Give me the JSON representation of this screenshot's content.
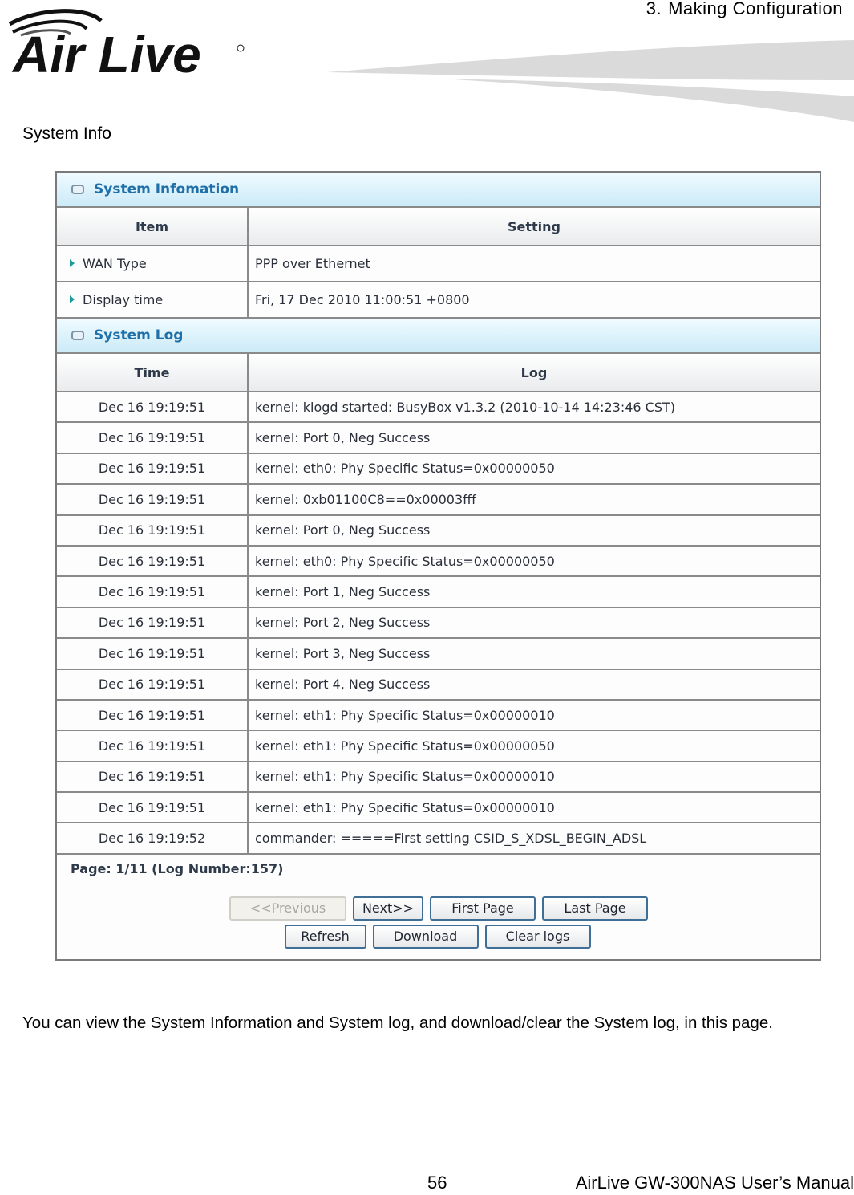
{
  "header": {
    "brand": "Air Live",
    "chapter_number": "3.",
    "chapter_title": "Making Configuration"
  },
  "section_title": "System Info",
  "system_information": {
    "title": "System Infomation",
    "columns": [
      "Item",
      "Setting"
    ],
    "rows": [
      {
        "item": "WAN Type",
        "setting": "PPP over Ethernet"
      },
      {
        "item": "Display time",
        "setting": "Fri, 17 Dec 2010 11:00:51 +0800"
      }
    ]
  },
  "system_log": {
    "title": "System Log",
    "columns": [
      "Time",
      "Log"
    ],
    "rows": [
      {
        "time": "Dec 16 19:19:51",
        "log": "kernel: klogd started: BusyBox v1.3.2 (2010-10-14 14:23:46 CST)"
      },
      {
        "time": "Dec 16 19:19:51",
        "log": "kernel: Port 0, Neg Success"
      },
      {
        "time": "Dec 16 19:19:51",
        "log": "kernel: eth0: Phy Specific Status=0x00000050"
      },
      {
        "time": "Dec 16 19:19:51",
        "log": "kernel: 0xb01100C8==0x00003fff"
      },
      {
        "time": "Dec 16 19:19:51",
        "log": "kernel: Port 0, Neg Success"
      },
      {
        "time": "Dec 16 19:19:51",
        "log": "kernel: eth0: Phy Specific Status=0x00000050"
      },
      {
        "time": "Dec 16 19:19:51",
        "log": "kernel: Port 1, Neg Success"
      },
      {
        "time": "Dec 16 19:19:51",
        "log": "kernel: Port 2, Neg Success"
      },
      {
        "time": "Dec 16 19:19:51",
        "log": "kernel: Port 3, Neg Success"
      },
      {
        "time": "Dec 16 19:19:51",
        "log": "kernel: Port 4, Neg Success"
      },
      {
        "time": "Dec 16 19:19:51",
        "log": "kernel: eth1: Phy Specific Status=0x00000010"
      },
      {
        "time": "Dec 16 19:19:51",
        "log": "kernel: eth1: Phy Specific Status=0x00000050"
      },
      {
        "time": "Dec 16 19:19:51",
        "log": "kernel: eth1: Phy Specific Status=0x00000010"
      },
      {
        "time": "Dec 16 19:19:51",
        "log": "kernel: eth1: Phy Specific Status=0x00000010"
      },
      {
        "time": "Dec 16 19:19:52",
        "log": "commander: =====First setting CSID_S_XDSL_BEGIN_ADSL"
      }
    ],
    "page_info": "Page: 1/11 (Log Number:157)",
    "buttons": {
      "previous": "<<Previous",
      "next": "Next>>",
      "first_page": "First Page",
      "last_page": "Last Page",
      "refresh": "Refresh",
      "download": "Download",
      "clear_logs": "Clear logs"
    }
  },
  "description": "You can view the System Information and System log, and download/clear the System log, in this page.",
  "footer": {
    "page_number": "56",
    "manual_title": "AirLive GW-300NAS User’s Manual"
  }
}
